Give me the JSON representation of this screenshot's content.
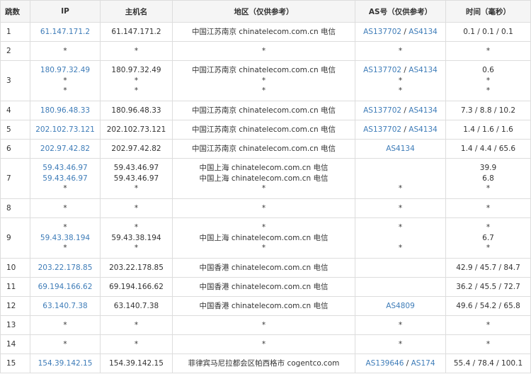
{
  "columns": {
    "hop": "跳数",
    "ip": "IP",
    "hostname": "主机名",
    "region": "地区（仅供参考）",
    "as": "AS号（仅供参考）",
    "time": "时间（毫秒）"
  },
  "rows": [
    {
      "hop": "1",
      "lines": [
        {
          "ip": "61.147.171.2",
          "host": "61.147.171.2",
          "region": "中国江苏南京 chinatelecom.com.cn 电信",
          "as": [
            "AS137702",
            "AS4134"
          ],
          "time": "0.1 / 0.1 / 0.1"
        }
      ]
    },
    {
      "hop": "2",
      "lines": [
        {
          "ip": "*",
          "host": "*",
          "region": "*",
          "as": [
            "*"
          ],
          "time": "*"
        }
      ]
    },
    {
      "hop": "3",
      "lines": [
        {
          "ip": "180.97.32.49",
          "host": "180.97.32.49",
          "region": "中国江苏南京 chinatelecom.com.cn 电信",
          "as": [
            "AS137702",
            "AS4134"
          ],
          "time": "0.6"
        },
        {
          "ip": "*",
          "host": "*",
          "region": "*",
          "as": [
            "*"
          ],
          "time": "*"
        },
        {
          "ip": "*",
          "host": "*",
          "region": "*",
          "as": [
            "*"
          ],
          "time": "*"
        }
      ]
    },
    {
      "hop": "4",
      "lines": [
        {
          "ip": "180.96.48.33",
          "host": "180.96.48.33",
          "region": "中国江苏南京 chinatelecom.com.cn 电信",
          "as": [
            "AS137702",
            "AS4134"
          ],
          "time": "7.3 / 8.8 / 10.2"
        }
      ]
    },
    {
      "hop": "5",
      "lines": [
        {
          "ip": "202.102.73.121",
          "host": "202.102.73.121",
          "region": "中国江苏南京 chinatelecom.com.cn 电信",
          "as": [
            "AS137702",
            "AS4134"
          ],
          "time": "1.4 / 1.6 / 1.6"
        }
      ]
    },
    {
      "hop": "6",
      "lines": [
        {
          "ip": "202.97.42.82",
          "host": "202.97.42.82",
          "region": "中国江苏南京 chinatelecom.com.cn 电信",
          "as": [
            "AS4134"
          ],
          "time": "1.4 / 4.4 / 65.6"
        }
      ]
    },
    {
      "hop": "7",
      "lines": [
        {
          "ip": "59.43.46.97",
          "host": "59.43.46.97",
          "region": "中国上海 chinatelecom.com.cn 电信",
          "as": [],
          "time": "39.9"
        },
        {
          "ip": "59.43.46.97",
          "host": "59.43.46.97",
          "region": "中国上海 chinatelecom.com.cn 电信",
          "as": [],
          "time": "6.8"
        },
        {
          "ip": "*",
          "host": "*",
          "region": "*",
          "as": [
            "*"
          ],
          "time": "*"
        }
      ]
    },
    {
      "hop": "8",
      "lines": [
        {
          "ip": "*",
          "host": "*",
          "region": "*",
          "as": [
            "*"
          ],
          "time": "*"
        }
      ]
    },
    {
      "hop": "9",
      "lines": [
        {
          "ip": "*",
          "host": "*",
          "region": "*",
          "as": [
            "*"
          ],
          "time": "*"
        },
        {
          "ip": "59.43.38.194",
          "host": "59.43.38.194",
          "region": "中国上海 chinatelecom.com.cn 电信",
          "as": [],
          "time": "6.7"
        },
        {
          "ip": "*",
          "host": "*",
          "region": "*",
          "as": [
            "*"
          ],
          "time": "*"
        }
      ]
    },
    {
      "hop": "10",
      "lines": [
        {
          "ip": "203.22.178.85",
          "host": "203.22.178.85",
          "region": "中国香港 chinatelecom.com.cn 电信",
          "as": [],
          "time": "42.9 / 45.7 / 84.7"
        }
      ]
    },
    {
      "hop": "11",
      "lines": [
        {
          "ip": "69.194.166.62",
          "host": "69.194.166.62",
          "region": "中国香港 chinatelecom.com.cn 电信",
          "as": [],
          "time": "36.2 / 45.5 / 72.7"
        }
      ]
    },
    {
      "hop": "12",
      "lines": [
        {
          "ip": "63.140.7.38",
          "host": "63.140.7.38",
          "region": "中国香港 chinatelecom.com.cn 电信",
          "as": [
            "AS4809"
          ],
          "time": "49.6 / 54.2 / 65.8"
        }
      ]
    },
    {
      "hop": "13",
      "lines": [
        {
          "ip": "*",
          "host": "*",
          "region": "*",
          "as": [
            "*"
          ],
          "time": "*"
        }
      ]
    },
    {
      "hop": "14",
      "lines": [
        {
          "ip": "*",
          "host": "*",
          "region": "*",
          "as": [
            "*"
          ],
          "time": "*"
        }
      ]
    },
    {
      "hop": "15",
      "lines": [
        {
          "ip": "154.39.142.15",
          "host": "154.39.142.15",
          "region": "菲律宾马尼拉都会区帕西格市 cogentco.com",
          "as": [
            "AS139646",
            "AS174"
          ],
          "time": "55.4 / 78.4 / 100.1"
        }
      ]
    }
  ]
}
